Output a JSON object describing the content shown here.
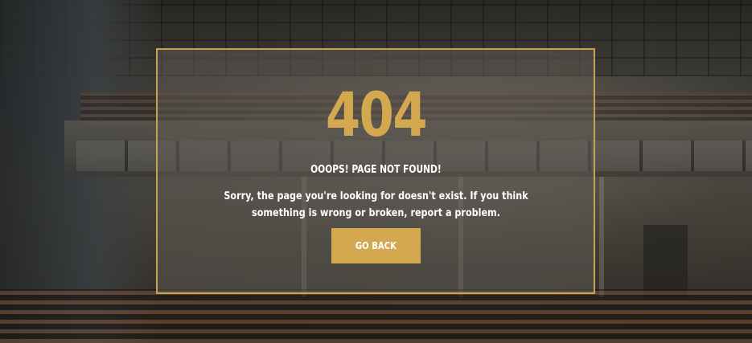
{
  "error": {
    "code": "404",
    "title": "OOOPS! PAGE NOT FOUND!",
    "message": "Sorry, the page you're looking for doesn't exist. If you think something is wrong or broken, report a problem.",
    "button_label": "GO BACK"
  },
  "colors": {
    "accent": "#d4a84f",
    "text": "#ffffff",
    "border": "#c8a24e"
  }
}
